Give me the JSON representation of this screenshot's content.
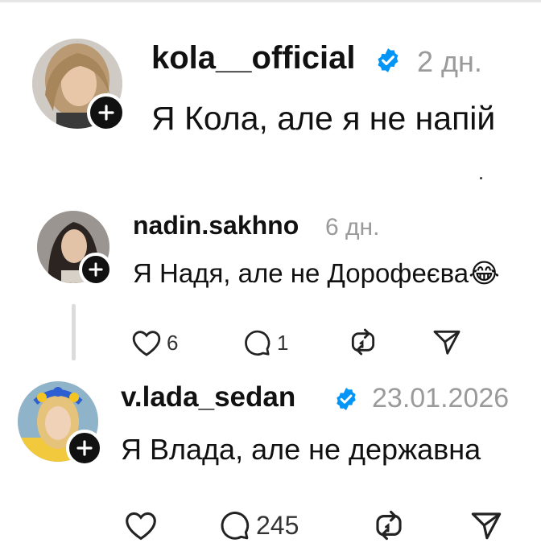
{
  "posts": [
    {
      "username": "kola__official",
      "time": "2 дн.",
      "text": "Я Кола, але я не напій",
      "verified": true
    },
    {
      "username": "nadin.sakhno",
      "time": "6 дн.",
      "text": "Я Надя, але не Дорофеєва",
      "emoji": "😂",
      "verified": false,
      "actions": {
        "likes": "6",
        "replies": "1"
      }
    },
    {
      "username": "v.lada_sedan",
      "time": "23.01.2026",
      "text": "Я Влада, але не державна",
      "verified": true,
      "actions": {
        "likes": "",
        "replies": "245"
      }
    }
  ],
  "colors": {
    "verified": "#0095f6",
    "muted": "#9a9a9a",
    "text": "#111111"
  },
  "icons": [
    "heart-icon",
    "comment-icon",
    "repost-icon",
    "share-icon",
    "plus-icon",
    "verified-badge-icon"
  ]
}
